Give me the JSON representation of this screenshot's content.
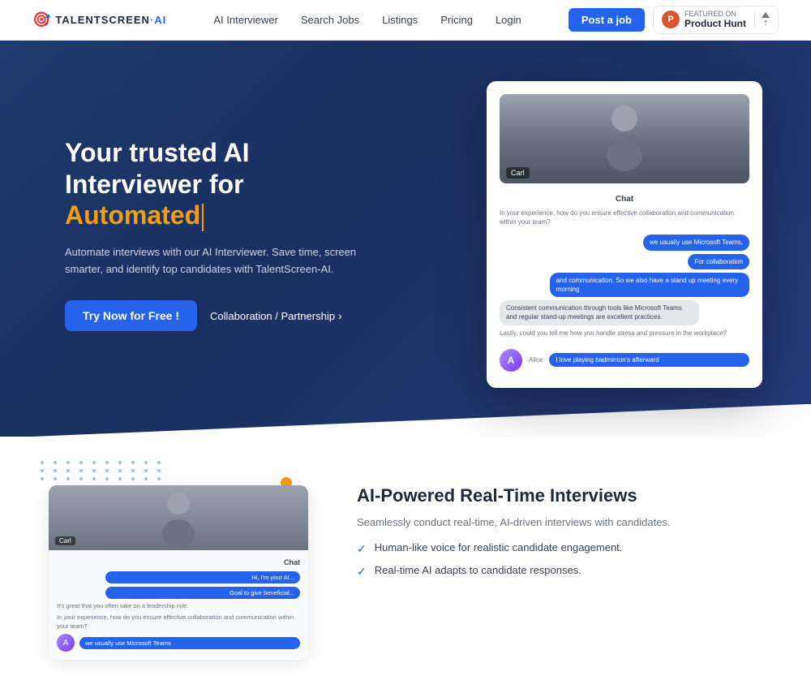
{
  "nav": {
    "logo_text": "TALENTSCREEN",
    "logo_ai": "·AI",
    "links": [
      "AI Interviewer",
      "Search Jobs",
      "Listings",
      "Pricing",
      "Login"
    ],
    "post_job_label": "Post a job",
    "product_hunt": {
      "label": "Product Hunt",
      "sub_label": "FEATURED ON",
      "vote_count": "↑"
    }
  },
  "hero": {
    "title_line1": "Your trusted AI",
    "title_line2": "Interviewer for",
    "title_highlight": "Automated",
    "description": "Automate interviews with our AI Interviewer. Save time, screen smarter, and identify top candidates with TalentScreen-AI.",
    "try_btn": "Try Now for Free !",
    "collab_btn": "Collaboration / Partnership",
    "chat_header": "Chat",
    "chat_question": "In your experience, how do you ensure effective collaboration and communication within your team?",
    "bubble1": "we usually use Microsoft Teams,",
    "bubble2": "For collaboration",
    "bubble3": "and communication. So we also have a stand up meeting every morning",
    "chat_desc": "Consistent communication through tools like Microsoft Teams and regular stand-up meetings are excellent practices.",
    "chat_question2": "Lastly, could you tell me how you handle stress and pressure in the workplace?",
    "bubble_answer": "I love playing badminton's afterward",
    "video_label": "Carl",
    "avatar_name": "Alice",
    "avatar_initial": "A"
  },
  "features": {
    "title": "AI-Powered Real-Time Interviews",
    "description": "Seamlessly conduct real-time, AI-driven interviews with candidates.",
    "items": [
      "Human-like voice for realistic candidate engagement.",
      "Real-time AI adapts to candidate responses."
    ],
    "card": {
      "video_label": "Carl",
      "chat_label": "Chat",
      "bubble1": "Hi, I'm your AI...",
      "bubble2": "Goal to give beneficial...",
      "text1": "It's great that you often take on a leadership role.",
      "text2": "In your experience, how do you ensure effective collaboration and communication within your team?",
      "answer": "we usually use Microsoft Teams"
    }
  }
}
